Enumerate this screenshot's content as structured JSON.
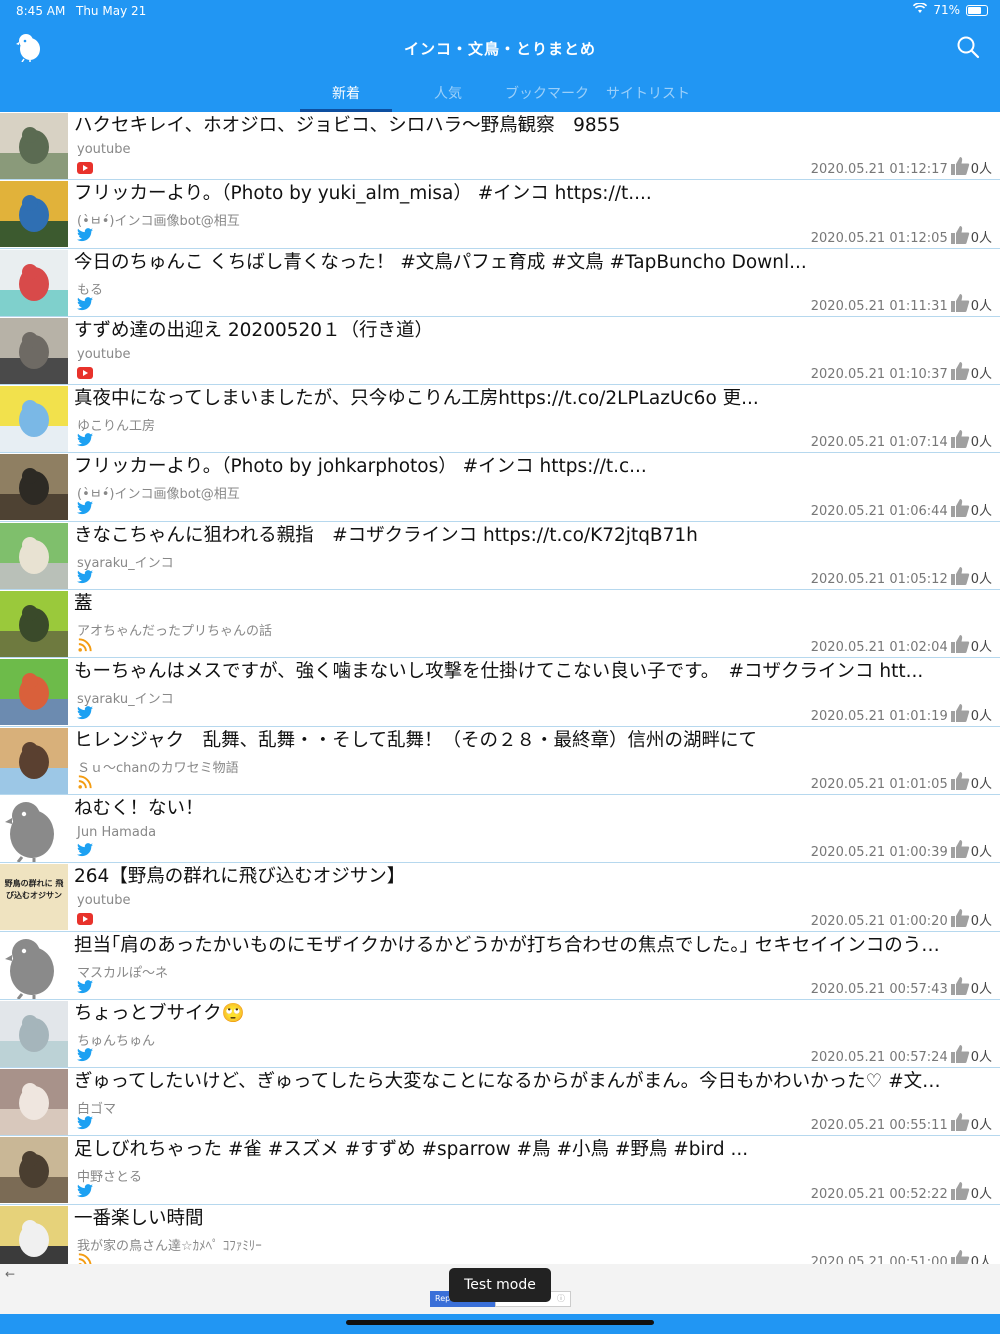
{
  "status": {
    "time": "8:45 AM",
    "date": "Thu May 21",
    "battery": "71%",
    "battery_level": 0.71
  },
  "header": {
    "title": "インコ・文鳥・とりまとめ",
    "logo_icon": "bird-logo-icon",
    "search_icon": "search-icon"
  },
  "tabs": [
    {
      "label": "新着",
      "active": true
    },
    {
      "label": "人気",
      "active": false
    },
    {
      "label": "ブックマーク",
      "active": false
    },
    {
      "label": "サイトリスト",
      "active": false
    }
  ],
  "colors": {
    "brand_blue": "#2196f3",
    "youtube_red": "#e8322b",
    "twitter_blue": "#1da1f2",
    "rss_orange": "#f39c12",
    "divider": "#b6d8ee"
  },
  "items": [
    {
      "title": "ハクセキレイ、ホオジロ、ジョビコ、シロハラ〜野鳥観察　9855",
      "source": "youtube",
      "source_type": "youtube",
      "timestamp": "2020.05.21 01:12:17",
      "likes": "0人",
      "thumb": "photo"
    },
    {
      "title": "フリッカーより。（Photo by yuki_alm_misa） #インコ https://t....",
      "source": "(•̀ㅂ•́)インコ画像bot@相互",
      "source_type": "twitter",
      "timestamp": "2020.05.21 01:12:05",
      "likes": "0人",
      "thumb": "photo"
    },
    {
      "title": "今日のちゅんこ くちばし青くなった！ #文鳥パフェ育成 #文鳥 #TapBuncho Downl...",
      "source": "もる",
      "source_type": "twitter",
      "timestamp": "2020.05.21 01:11:31",
      "likes": "0人",
      "thumb": "photo"
    },
    {
      "title": "すずめ達の出迎え 20200520１（行き道）",
      "source": "youtube",
      "source_type": "youtube",
      "timestamp": "2020.05.21 01:10:37",
      "likes": "0人",
      "thumb": "photo"
    },
    {
      "title": "真夜中になってしまいましたが、只今ゆこりん工房https://t.co/2LPLazUc6o 更...",
      "source": "ゆこりん工房",
      "source_type": "twitter",
      "timestamp": "2020.05.21 01:07:14",
      "likes": "0人",
      "thumb": "photo"
    },
    {
      "title": "フリッカーより。（Photo by johkarphotos） #インコ https://t.c...",
      "source": "(•̀ㅂ•́)インコ画像bot@相互",
      "source_type": "twitter",
      "timestamp": "2020.05.21 01:06:44",
      "likes": "0人",
      "thumb": "photo"
    },
    {
      "title": "きなこちゃんに狙われる親指　#コザクラインコ https://t.co/K72jtqB71h",
      "source": "syaraku_インコ",
      "source_type": "twitter",
      "timestamp": "2020.05.21 01:05:12",
      "likes": "0人",
      "thumb": "photo"
    },
    {
      "title": "蓋",
      "source": "アオちゃんだったプリちゃんの話",
      "source_type": "rss",
      "timestamp": "2020.05.21 01:02:04",
      "likes": "0人",
      "thumb": "photo"
    },
    {
      "title": "もーちゃんはメスですが、強く噛まないし攻撃を仕掛けてこない良い子です。　#コザクラインコ htt...",
      "source": "syaraku_インコ",
      "source_type": "twitter",
      "timestamp": "2020.05.21 01:01:19",
      "likes": "0人",
      "thumb": "photo"
    },
    {
      "title": "ヒレンジャク　乱舞、乱舞・・そして乱舞！（その２８・最終章）信州の湖畔にて",
      "source": "Ｓｕ〜chanのカワセミ物語",
      "source_type": "rss",
      "timestamp": "2020.05.21 01:01:05",
      "likes": "0人",
      "thumb": "photo"
    },
    {
      "title": "ねむく！ない！",
      "source": "Jun Hamada",
      "source_type": "twitter",
      "timestamp": "2020.05.21 01:00:39",
      "likes": "0人",
      "thumb": "placeholder"
    },
    {
      "title": "264【野鳥の群れに飛び込むオジサン】",
      "source": "youtube",
      "source_type": "youtube",
      "timestamp": "2020.05.21 01:00:20",
      "likes": "0人",
      "thumb": "text",
      "thumb_text": "野鳥の群れに 飛び込むオジサン"
    },
    {
      "title": "担当｢肩のあったかいものにモザイクかけるかどうかが打ち合わせの焦点でした。｣ セキセイインコのう…",
      "source": "マスカルぽ〜ネ",
      "source_type": "twitter",
      "timestamp": "2020.05.21 00:57:43",
      "likes": "0人",
      "thumb": "placeholder"
    },
    {
      "title": "ちょっとブサイク🙄",
      "source": "ちゅんちゅん",
      "source_type": "twitter",
      "timestamp": "2020.05.21 00:57:24",
      "likes": "0人",
      "thumb": "photo"
    },
    {
      "title": "ぎゅってしたいけど、ぎゅってしたら大変なことになるからがまんがまん。今日もかわいかった♡ #文…",
      "source": "白ゴマ",
      "source_type": "twitter",
      "timestamp": "2020.05.21 00:55:11",
      "likes": "0人",
      "thumb": "photo"
    },
    {
      "title": "足しびれちゃった #雀 #スズメ #すずめ #sparrow #鳥 #小鳥 #野鳥 #bird ...",
      "source": "中野さとる",
      "source_type": "twitter",
      "timestamp": "2020.05.21 00:52:22",
      "likes": "0人",
      "thumb": "photo"
    },
    {
      "title": "一番楽しい時間",
      "source": "我が家の鳥さん達☆ｶﾒﾍﾟ ｺﾌｧﾐﾘｰ",
      "source_type": "rss",
      "timestamp": "2020.05.21 00:51:00",
      "likes": "0人",
      "thumb": "photo"
    }
  ],
  "ad": {
    "test_mode_label": "Test mode",
    "button_label": "Report this ad",
    "back_icon": "back-arrow-icon",
    "info_icon": "info-icon"
  }
}
